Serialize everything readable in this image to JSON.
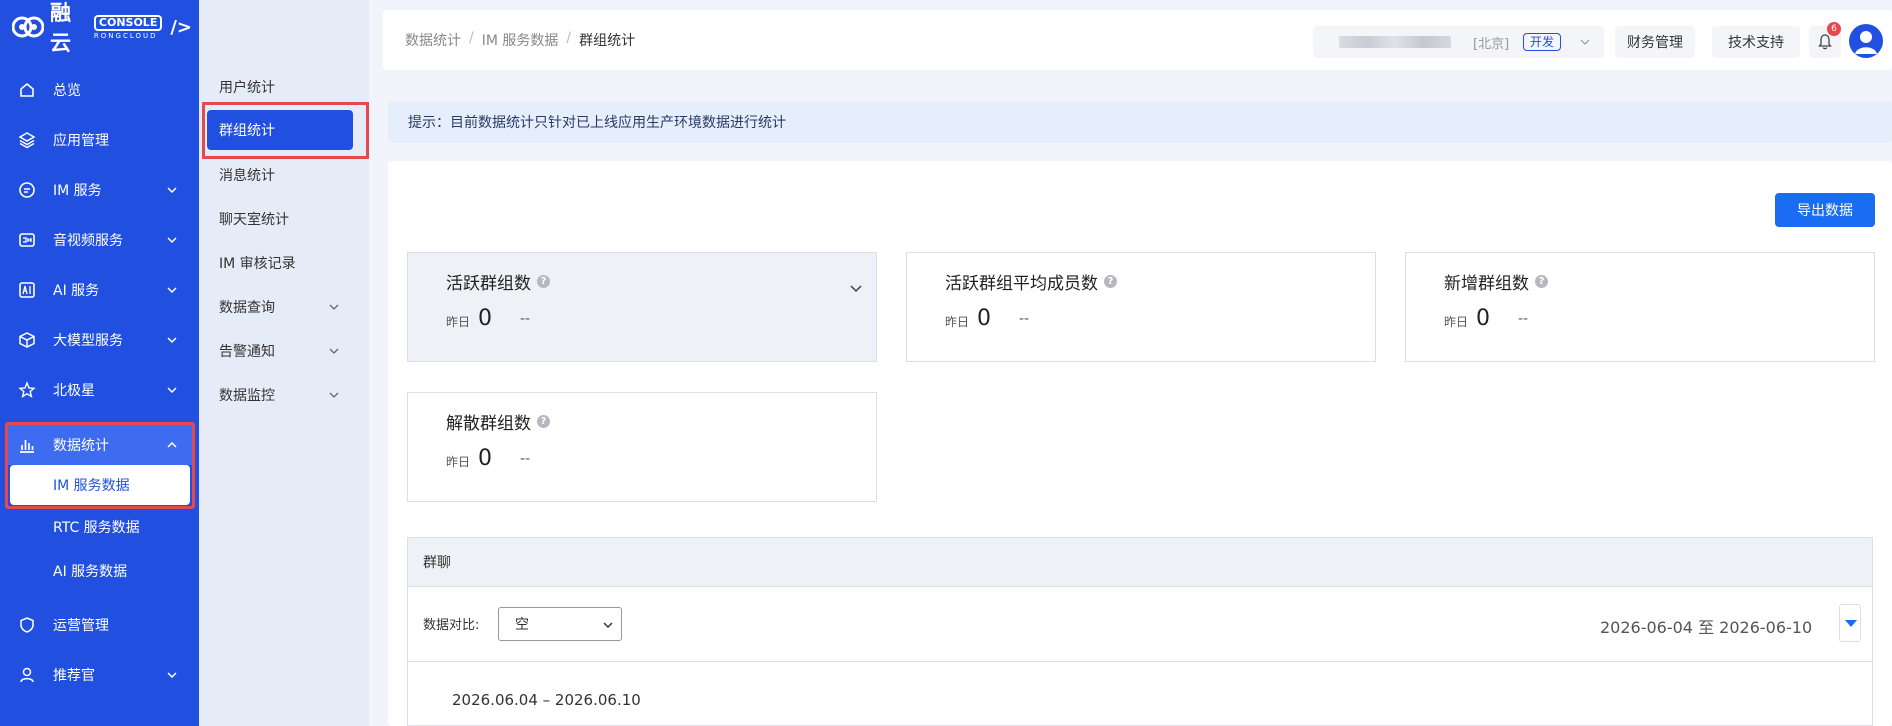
{
  "brand": {
    "name": "融云",
    "console": "CONSOLE",
    "sub": "RONGCLOUD"
  },
  "sidebar": {
    "items": [
      {
        "label": "总览",
        "icon": "home-icon"
      },
      {
        "label": "应用管理",
        "icon": "layers-icon"
      },
      {
        "label": "IM 服务",
        "icon": "chat-icon"
      },
      {
        "label": "音视频服务",
        "icon": "media-icon"
      },
      {
        "label": "AI 服务",
        "icon": "ai-icon"
      },
      {
        "label": "大模型服务",
        "icon": "cube-icon"
      },
      {
        "label": "北极星",
        "icon": "star-icon"
      },
      {
        "label": "数据统计",
        "icon": "bar-chart-icon"
      },
      {
        "label": "运营管理",
        "icon": "shield-icon"
      },
      {
        "label": "推荐官",
        "icon": "user-icon"
      }
    ],
    "data_sub": [
      {
        "label": "IM 服务数据"
      },
      {
        "label": "RTC 服务数据"
      },
      {
        "label": "AI 服务数据"
      }
    ]
  },
  "subnav": {
    "items": [
      {
        "label": "用户统计"
      },
      {
        "label": "群组统计"
      },
      {
        "label": "消息统计"
      },
      {
        "label": "聊天室统计"
      },
      {
        "label": "IM 审核记录"
      },
      {
        "label": "数据查询"
      },
      {
        "label": "告警通知"
      },
      {
        "label": "数据监控"
      }
    ]
  },
  "header": {
    "breadcrumb": [
      "数据统计",
      "IM 服务数据",
      "群组统计"
    ],
    "region": "[北京]",
    "env": "开发",
    "finance": "财务管理",
    "support": "技术支持",
    "notif_count": "6"
  },
  "tip": "提示：目前数据统计只针对已上线应用生产环境数据进行统计",
  "main": {
    "export_label": "导出数据",
    "stats": [
      {
        "title": "活跃群组数",
        "yesterday_label": "昨日",
        "value": "0",
        "compare": "--"
      },
      {
        "title": "活跃群组平均成员数",
        "yesterday_label": "昨日",
        "value": "0",
        "compare": "--"
      },
      {
        "title": "新增群组数",
        "yesterday_label": "昨日",
        "value": "0",
        "compare": "--"
      },
      {
        "title": "解散群组数",
        "yesterday_label": "昨日",
        "value": "0",
        "compare": "--"
      }
    ],
    "panel": {
      "title": "群聊",
      "compare_label": "数据对比:",
      "compare_value": "空",
      "date_range": "2026-06-04 至 2026-06-10",
      "period": "2026.06.04 – 2026.06.10"
    }
  },
  "colors": {
    "primary": "#2150e0",
    "highlight": "#e5484d",
    "button": "#1a6cf2"
  }
}
